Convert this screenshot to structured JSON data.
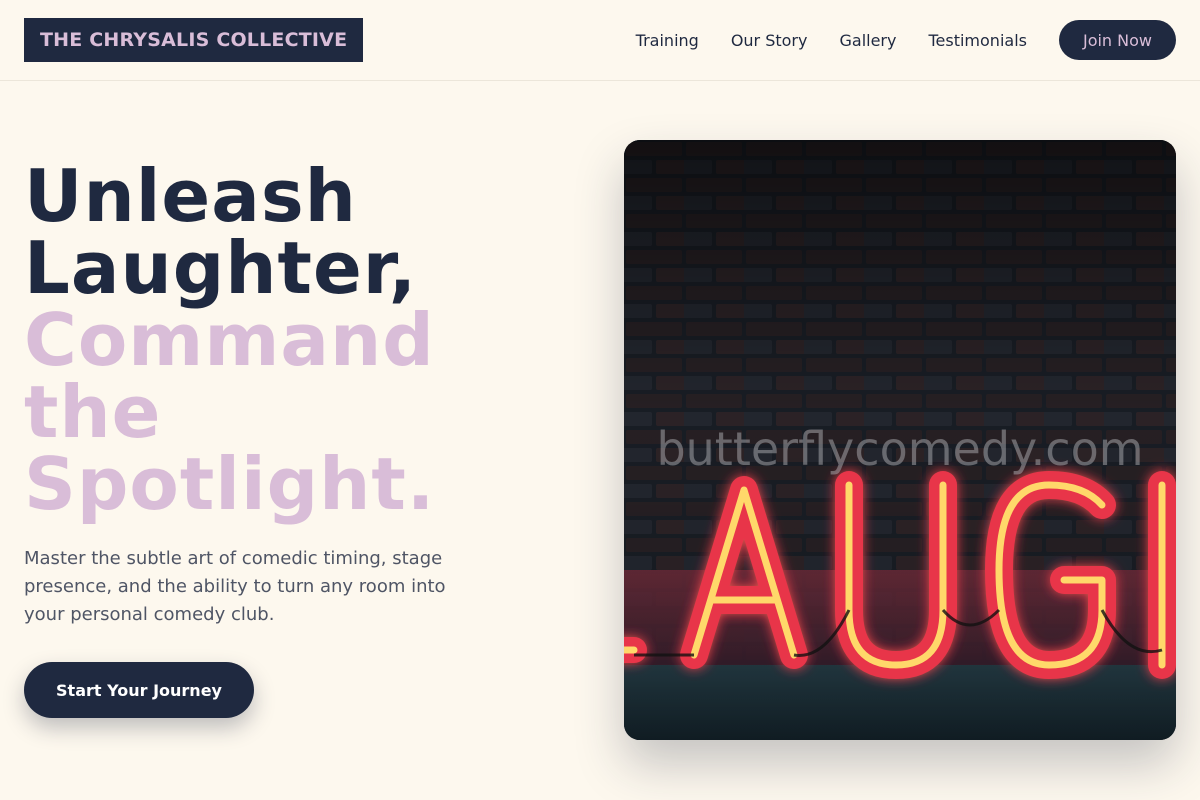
{
  "brand": {
    "name": "THE CHRYSALIS COLLECTIVE"
  },
  "nav": {
    "links": [
      "Training",
      "Our Story",
      "Gallery",
      "Testimonials"
    ],
    "cta_label": "Join Now"
  },
  "hero": {
    "title_line1": "Unleash",
    "title_line2": "Laughter,",
    "title_line3": "Command",
    "title_line4": "the",
    "title_line5": "Spotlight.",
    "subtitle": "Master the subtle art of comedic timing, stage presence, and the ability to turn any room into your personal comedy club.",
    "cta_label": "Start Your Journey"
  },
  "image": {
    "sign_text": "LAUGH",
    "watermark": "butterflycomedy.com",
    "icon": "neon-sign-photo"
  },
  "colors": {
    "background": "#fdf8ee",
    "navy": "#1f2940",
    "lavender": "#d9bdd8",
    "body_text": "#4f5565",
    "neon_red": "#e8344a",
    "neon_yellow": "#ffd86a"
  }
}
